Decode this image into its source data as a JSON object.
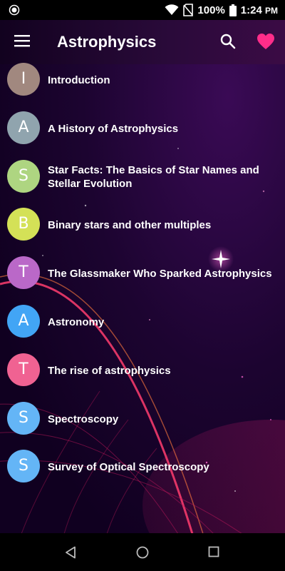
{
  "status_bar": {
    "battery": "100%",
    "time": "1:24",
    "time_suffix": "PM"
  },
  "app_bar": {
    "title": "Astrophysics",
    "icons": [
      "menu-icon",
      "search-icon",
      "heart-icon"
    ]
  },
  "colors": {
    "heart": "#ff2d8a",
    "text": "#ffffff"
  },
  "items": [
    {
      "letter": "I",
      "title": "Introduction",
      "color": "#a1887f"
    },
    {
      "letter": "A",
      "title": "A History of Astrophysics",
      "color": "#90a4ae"
    },
    {
      "letter": "S",
      "title": "Star Facts: The Basics of Star Names and Stellar Evolution",
      "color": "#aed581"
    },
    {
      "letter": "B",
      "title": "Binary stars and other multiples",
      "color": "#d4e157"
    },
    {
      "letter": "T",
      "title": "The Glassmaker Who Sparked Astrophysics",
      "color": "#ba68c8"
    },
    {
      "letter": "A",
      "title": "Astronomy",
      "color": "#42a5f5"
    },
    {
      "letter": "T",
      "title": "The rise of astrophysics",
      "color": "#f06292"
    },
    {
      "letter": "S",
      "title": "Spectroscopy",
      "color": "#64b5f6"
    },
    {
      "letter": "S",
      "title": "Survey of Optical Spectroscopy",
      "color": "#64b5f6"
    }
  ],
  "nav_bar": {
    "icons": [
      "back-icon",
      "home-icon",
      "recents-icon"
    ]
  }
}
